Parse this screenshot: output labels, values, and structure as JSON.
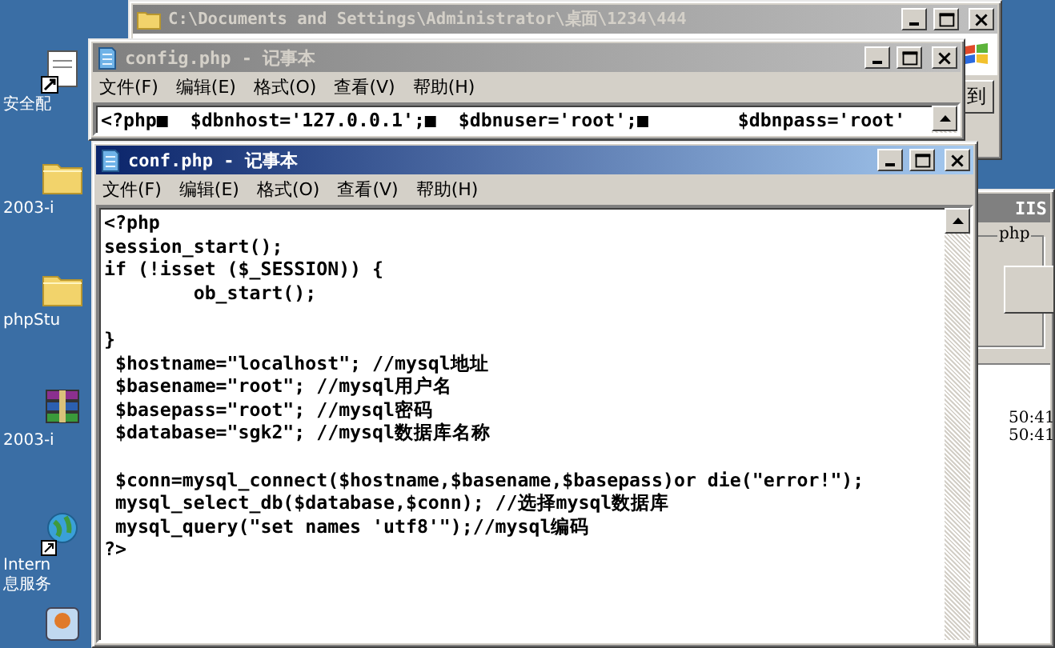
{
  "desktop_icons": [
    {
      "kind": "shortcut",
      "label": "安全配"
    },
    {
      "kind": "folder",
      "label": "2003-i"
    },
    {
      "kind": "folder",
      "label": "phpStu"
    },
    {
      "kind": "archive",
      "label": "2003-i"
    },
    {
      "kind": "globe",
      "label": "Intern\n息服务"
    },
    {
      "kind": "app"
    }
  ],
  "explorer_window": {
    "title": "C:\\Documents and Settings\\Administrator\\桌面\\1234\\444",
    "active": false,
    "go_button": "到"
  },
  "side_window": {
    "title": "IIS",
    "group_label": "php",
    "active": false,
    "log_lines": [
      "50:41",
      "50:41"
    ]
  },
  "notepad_windows": [
    {
      "title": "config.php - 记事本",
      "active": false,
      "menu": [
        "文件(F)",
        "编辑(E)",
        "格式(O)",
        "查看(V)",
        "帮助(H)"
      ],
      "text": "<?php■  $dbnhost='127.0.0.1';■  $dbnuser='root';■        $dbnpass='root'"
    },
    {
      "title": "conf.php - 记事本",
      "active": true,
      "menu": [
        "文件(F)",
        "编辑(E)",
        "格式(O)",
        "查看(V)",
        "帮助(H)"
      ],
      "text": "<?php\nsession_start();\nif (!isset ($_SESSION)) {\n        ob_start();\n\n}\n $hostname=\"localhost\"; //mysql地址\n $basename=\"root\"; //mysql用户名\n $basepass=\"root\"; //mysql密码\n $database=\"sgk2\"; //mysql数据库名称\n\n $conn=mysql_connect($hostname,$basename,$basepass)or die(\"error!\");\n mysql_select_db($database,$conn); //选择mysql数据库\n mysql_query(\"set names 'utf8'\");//mysql编码\n?>"
    }
  ]
}
